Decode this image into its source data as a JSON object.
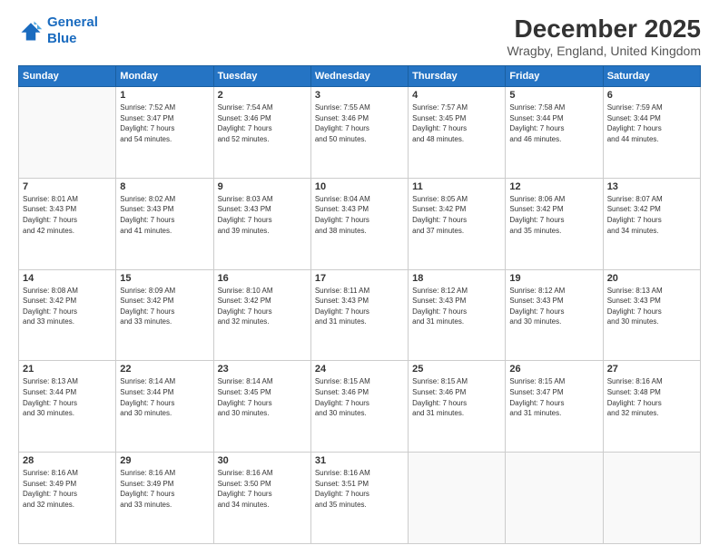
{
  "header": {
    "logo_line1": "General",
    "logo_line2": "Blue",
    "title": "December 2025",
    "subtitle": "Wragby, England, United Kingdom"
  },
  "days_of_week": [
    "Sunday",
    "Monday",
    "Tuesday",
    "Wednesday",
    "Thursday",
    "Friday",
    "Saturday"
  ],
  "weeks": [
    [
      {
        "day": "",
        "info": ""
      },
      {
        "day": "1",
        "info": "Sunrise: 7:52 AM\nSunset: 3:47 PM\nDaylight: 7 hours\nand 54 minutes."
      },
      {
        "day": "2",
        "info": "Sunrise: 7:54 AM\nSunset: 3:46 PM\nDaylight: 7 hours\nand 52 minutes."
      },
      {
        "day": "3",
        "info": "Sunrise: 7:55 AM\nSunset: 3:46 PM\nDaylight: 7 hours\nand 50 minutes."
      },
      {
        "day": "4",
        "info": "Sunrise: 7:57 AM\nSunset: 3:45 PM\nDaylight: 7 hours\nand 48 minutes."
      },
      {
        "day": "5",
        "info": "Sunrise: 7:58 AM\nSunset: 3:44 PM\nDaylight: 7 hours\nand 46 minutes."
      },
      {
        "day": "6",
        "info": "Sunrise: 7:59 AM\nSunset: 3:44 PM\nDaylight: 7 hours\nand 44 minutes."
      }
    ],
    [
      {
        "day": "7",
        "info": "Sunrise: 8:01 AM\nSunset: 3:43 PM\nDaylight: 7 hours\nand 42 minutes."
      },
      {
        "day": "8",
        "info": "Sunrise: 8:02 AM\nSunset: 3:43 PM\nDaylight: 7 hours\nand 41 minutes."
      },
      {
        "day": "9",
        "info": "Sunrise: 8:03 AM\nSunset: 3:43 PM\nDaylight: 7 hours\nand 39 minutes."
      },
      {
        "day": "10",
        "info": "Sunrise: 8:04 AM\nSunset: 3:43 PM\nDaylight: 7 hours\nand 38 minutes."
      },
      {
        "day": "11",
        "info": "Sunrise: 8:05 AM\nSunset: 3:42 PM\nDaylight: 7 hours\nand 37 minutes."
      },
      {
        "day": "12",
        "info": "Sunrise: 8:06 AM\nSunset: 3:42 PM\nDaylight: 7 hours\nand 35 minutes."
      },
      {
        "day": "13",
        "info": "Sunrise: 8:07 AM\nSunset: 3:42 PM\nDaylight: 7 hours\nand 34 minutes."
      }
    ],
    [
      {
        "day": "14",
        "info": "Sunrise: 8:08 AM\nSunset: 3:42 PM\nDaylight: 7 hours\nand 33 minutes."
      },
      {
        "day": "15",
        "info": "Sunrise: 8:09 AM\nSunset: 3:42 PM\nDaylight: 7 hours\nand 33 minutes."
      },
      {
        "day": "16",
        "info": "Sunrise: 8:10 AM\nSunset: 3:42 PM\nDaylight: 7 hours\nand 32 minutes."
      },
      {
        "day": "17",
        "info": "Sunrise: 8:11 AM\nSunset: 3:43 PM\nDaylight: 7 hours\nand 31 minutes."
      },
      {
        "day": "18",
        "info": "Sunrise: 8:12 AM\nSunset: 3:43 PM\nDaylight: 7 hours\nand 31 minutes."
      },
      {
        "day": "19",
        "info": "Sunrise: 8:12 AM\nSunset: 3:43 PM\nDaylight: 7 hours\nand 30 minutes."
      },
      {
        "day": "20",
        "info": "Sunrise: 8:13 AM\nSunset: 3:43 PM\nDaylight: 7 hours\nand 30 minutes."
      }
    ],
    [
      {
        "day": "21",
        "info": "Sunrise: 8:13 AM\nSunset: 3:44 PM\nDaylight: 7 hours\nand 30 minutes."
      },
      {
        "day": "22",
        "info": "Sunrise: 8:14 AM\nSunset: 3:44 PM\nDaylight: 7 hours\nand 30 minutes."
      },
      {
        "day": "23",
        "info": "Sunrise: 8:14 AM\nSunset: 3:45 PM\nDaylight: 7 hours\nand 30 minutes."
      },
      {
        "day": "24",
        "info": "Sunrise: 8:15 AM\nSunset: 3:46 PM\nDaylight: 7 hours\nand 30 minutes."
      },
      {
        "day": "25",
        "info": "Sunrise: 8:15 AM\nSunset: 3:46 PM\nDaylight: 7 hours\nand 31 minutes."
      },
      {
        "day": "26",
        "info": "Sunrise: 8:15 AM\nSunset: 3:47 PM\nDaylight: 7 hours\nand 31 minutes."
      },
      {
        "day": "27",
        "info": "Sunrise: 8:16 AM\nSunset: 3:48 PM\nDaylight: 7 hours\nand 32 minutes."
      }
    ],
    [
      {
        "day": "28",
        "info": "Sunrise: 8:16 AM\nSunset: 3:49 PM\nDaylight: 7 hours\nand 32 minutes."
      },
      {
        "day": "29",
        "info": "Sunrise: 8:16 AM\nSunset: 3:49 PM\nDaylight: 7 hours\nand 33 minutes."
      },
      {
        "day": "30",
        "info": "Sunrise: 8:16 AM\nSunset: 3:50 PM\nDaylight: 7 hours\nand 34 minutes."
      },
      {
        "day": "31",
        "info": "Sunrise: 8:16 AM\nSunset: 3:51 PM\nDaylight: 7 hours\nand 35 minutes."
      },
      {
        "day": "",
        "info": ""
      },
      {
        "day": "",
        "info": ""
      },
      {
        "day": "",
        "info": ""
      }
    ]
  ]
}
